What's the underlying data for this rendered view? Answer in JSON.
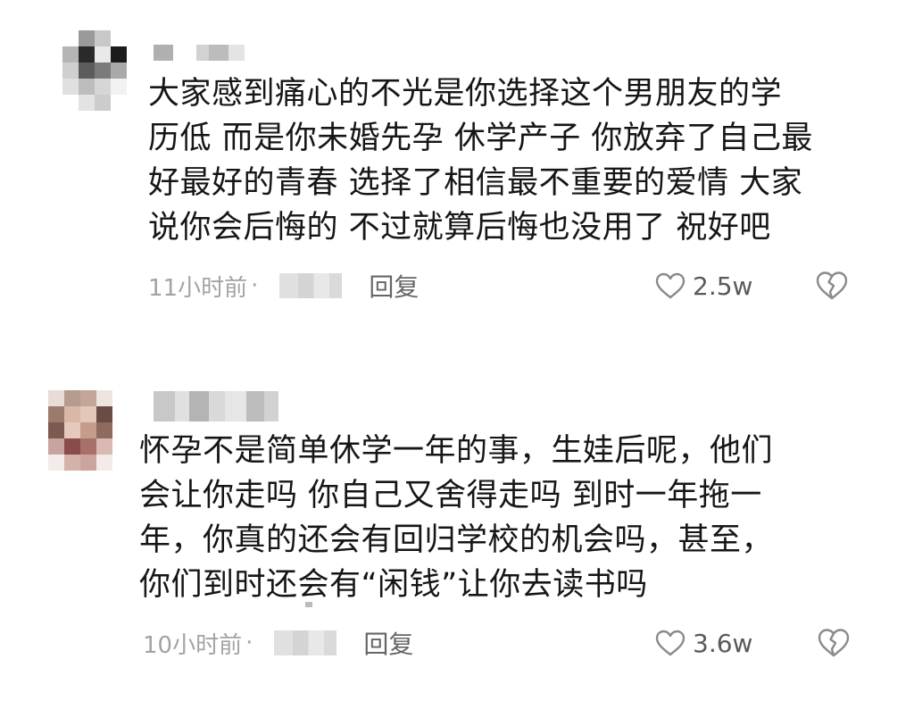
{
  "comments": [
    {
      "text": "大家感到痛心的不光是你选择这个男朋友的学\n历低 而是你未婚先孕 休学产子 你放弃了自己最\n好最好的青春 选择了相信最不重要的爱情 大家\n说你会后悔的 不过就算后悔也没用了 祝好吧",
      "time": "11小时前",
      "dot": "·",
      "reply": "回复",
      "likes": "2.5w"
    },
    {
      "text": "怀孕不是简单休学一年的事，生娃后呢，他们\n会让你走吗 你自己又舍得走吗 到时一年拖一\n年，你真的还会有回归学校的机会吗，甚至，\n你们到时还会有“闲钱”让你去读书吗",
      "time": "10小时前",
      "dot": "·",
      "reply": "回复",
      "likes": "3.6w"
    }
  ],
  "icons": {
    "like": "heart-outline-icon",
    "dislike": "broken-heart-icon"
  },
  "colors": {
    "text": "#161616",
    "meta": "#a3a3a3",
    "reply": "#666666",
    "icon": "#8a8a8a"
  }
}
